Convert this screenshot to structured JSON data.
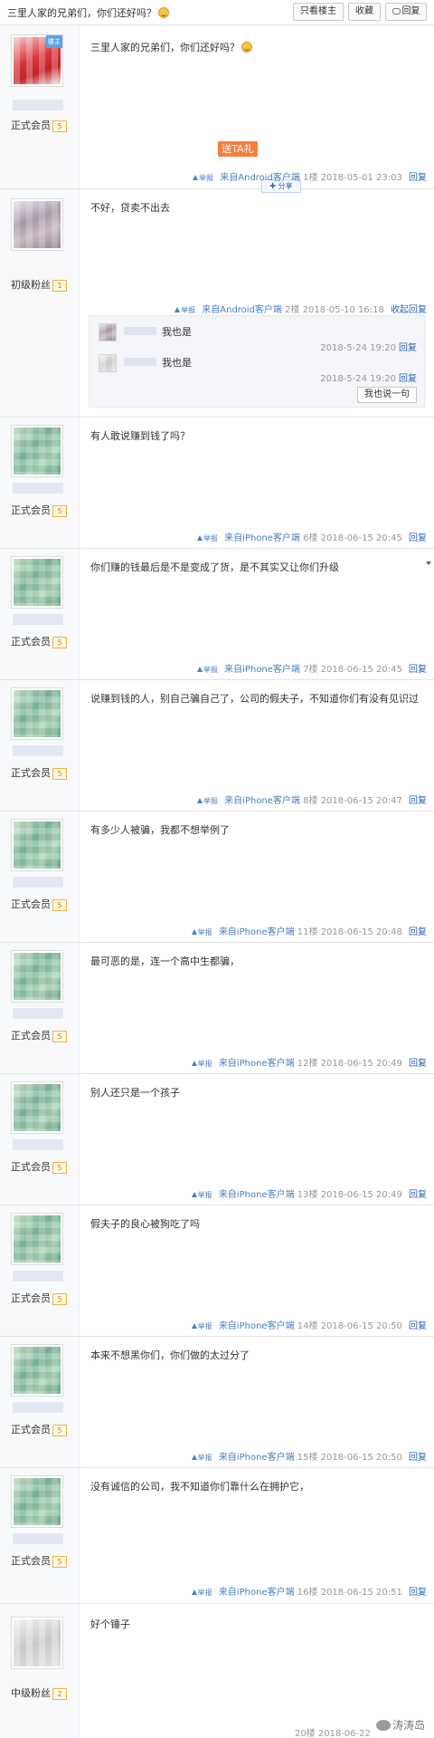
{
  "header": {
    "title": "三里人家的兄弟们，你们还好吗？",
    "only_op_label": "只看楼主",
    "favorite_label": "收藏",
    "reply_label": "回复"
  },
  "op": {
    "badge": "楼主",
    "rank": "正式会员",
    "level": "5",
    "text": "三里人家的兄弟们，你们还好吗？",
    "gift_label": "送TA礼",
    "share_label": "分享",
    "report": "举报",
    "client": "来自Android客户端",
    "floor": "1楼",
    "time": "2018-05-01 23:03",
    "reply": "回复"
  },
  "post2": {
    "rank": "初级粉丝",
    "level": "1",
    "text": "不好，贷卖不出去",
    "report": "举报",
    "client": "来自Android客户端",
    "floor": "2楼",
    "time": "2018-05-10 16:18",
    "reply": "收起回复",
    "subreplies": [
      {
        "text": "我也是",
        "time": "2018-5-24 19:20",
        "reply": "回复"
      },
      {
        "text": "我也是",
        "time": "2018-5-24 19:20",
        "reply": "回复"
      }
    ],
    "say_button": "我也说一句"
  },
  "posts": [
    {
      "rank": "正式会员",
      "level": "5",
      "text": "有人敢说赚到钱了吗？",
      "report": "举报",
      "client": "来自iPhone客户端",
      "floor": "6楼",
      "time": "2018-06-15 20:45",
      "reply": "回复"
    },
    {
      "rank": "正式会员",
      "level": "5",
      "text": "你们赚的钱最后是不是变成了货，是不其实又让你们升级",
      "report": "举报",
      "client": "来自iPhone客户端",
      "floor": "7楼",
      "time": "2018-06-15 20:45",
      "reply": "回复"
    },
    {
      "rank": "正式会员",
      "level": "5",
      "text": "说赚到钱的人，别自己骗自己了，公司的假夫子，不知道你们有没有见识过",
      "report": "举报",
      "client": "来自iPhone客户端",
      "floor": "8楼",
      "time": "2018-06-15 20:47",
      "reply": "回复"
    },
    {
      "rank": "正式会员",
      "level": "5",
      "text": "有多少人被骗，我都不想举例了",
      "report": "举报",
      "client": "来自iPhone客户端",
      "floor": "11楼",
      "time": "2018-06-15 20:48",
      "reply": "回复"
    },
    {
      "rank": "正式会员",
      "level": "5",
      "text": "最可恶的是，连一个高中生都骗，",
      "report": "举报",
      "client": "来自iPhone客户端",
      "floor": "12楼",
      "time": "2018-06-15 20:49",
      "reply": "回复"
    },
    {
      "rank": "正式会员",
      "level": "5",
      "text": "别人还只是一个孩子",
      "report": "举报",
      "client": "来自iPhone客户端",
      "floor": "13楼",
      "time": "2018-06-15 20:49",
      "reply": "回复"
    },
    {
      "rank": "正式会员",
      "level": "5",
      "text": "假夫子的良心被狗吃了吗",
      "report": "举报",
      "client": "来自iPhone客户端",
      "floor": "14楼",
      "time": "2018-06-15 20:50",
      "reply": "回复"
    },
    {
      "rank": "正式会员",
      "level": "5",
      "text": "本来不想黑你们，你们做的太过分了",
      "report": "举报",
      "client": "来自iPhone客户端",
      "floor": "15楼",
      "time": "2018-06-15 20:50",
      "reply": "回复"
    },
    {
      "rank": "正式会员",
      "level": "5",
      "text": "没有诚信的公司，我不知道你们靠什么在拥护它，",
      "report": "举报",
      "client": "来自iPhone客户端",
      "floor": "16楼",
      "time": "2018-06-15 20:51",
      "reply": "回复"
    }
  ],
  "last": {
    "rank": "中级粉丝",
    "level": "2",
    "text": "好个锤子",
    "floor": "20楼",
    "time": "2018-06-22"
  },
  "watermark": "涛涛岛"
}
